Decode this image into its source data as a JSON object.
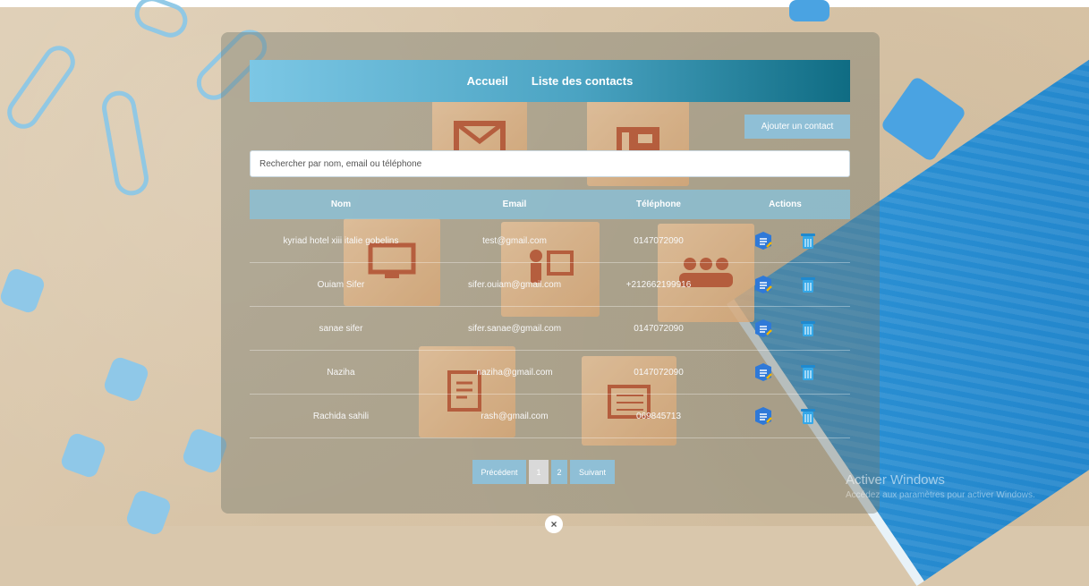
{
  "nav": {
    "links": [
      "Accueil",
      "Liste des contacts"
    ]
  },
  "actions": {
    "add_contact": "Ajouter un contact"
  },
  "search": {
    "placeholder": "Rechercher par nom, email ou téléphone",
    "value": ""
  },
  "table": {
    "headers": [
      "Nom",
      "Email",
      "Téléphone",
      "Actions"
    ],
    "rows": [
      {
        "name": "kyriad hotel xiii italie gobelins",
        "email": "test@gmail.com",
        "phone": "0147072090"
      },
      {
        "name": "Ouiam Sifer",
        "email": "sifer.ouiam@gmail.com",
        "phone": "+212662199916"
      },
      {
        "name": "sanae sifer",
        "email": "sifer.sanae@gmail.com",
        "phone": "0147072090"
      },
      {
        "name": "Naziha",
        "email": "naziha@gmail.com",
        "phone": "0147072090"
      },
      {
        "name": "Rachida sahili",
        "email": "rash@gmail.com",
        "phone": "069845713"
      }
    ]
  },
  "pagination": {
    "prev": "Précédent",
    "pages": [
      "1",
      "2"
    ],
    "next": "Suivant",
    "current": "1"
  },
  "footer": {
    "close_symbol": "×"
  },
  "watermark": {
    "title": "Activer Windows",
    "subtitle": "Accédez aux paramètres pour activer Windows."
  },
  "colors": {
    "header_start": "#7cc7e5",
    "header_end": "#0f6c83",
    "button": "#8fbfd6",
    "table_header": "#85c3e0"
  },
  "icons": {
    "edit": "edit-icon",
    "delete": "delete-icon",
    "close": "close-icon"
  }
}
